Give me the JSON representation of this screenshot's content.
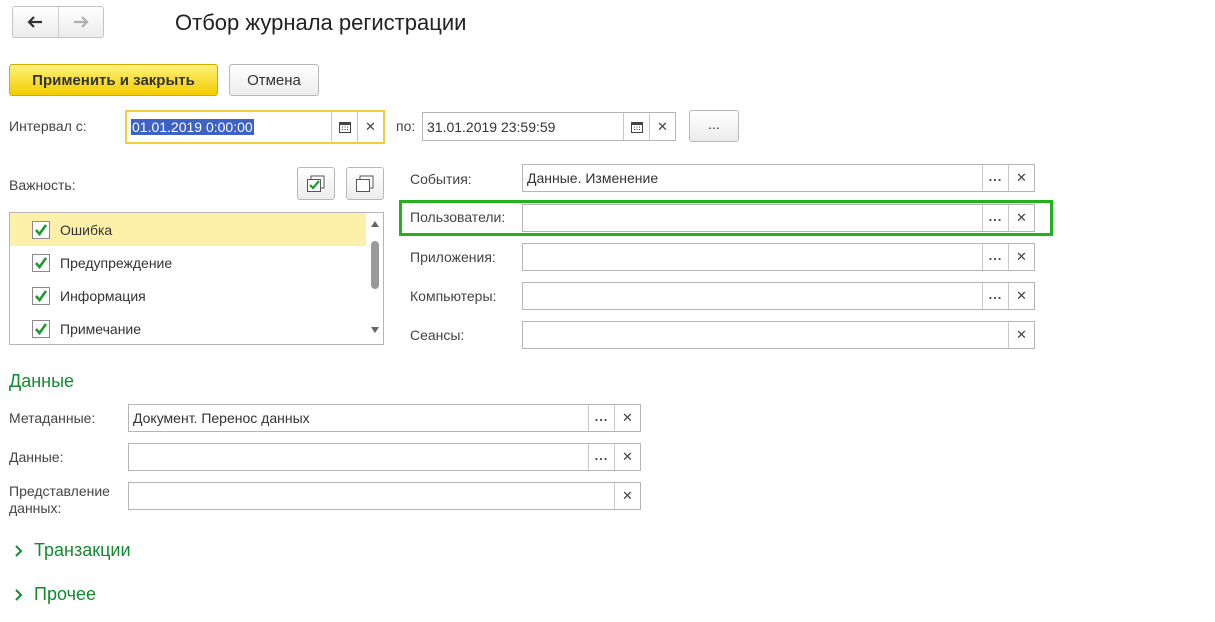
{
  "window": {
    "title": "Отбор журнала регистрации"
  },
  "nav": {
    "back_icon": "arrow-left-icon",
    "forward_icon": "arrow-right-icon"
  },
  "toolbar": {
    "apply_close_label": "Применить и закрыть",
    "cancel_label": "Отмена"
  },
  "interval": {
    "from_label": "Интервал с:",
    "from_value": "01.01.2019  0:00:00",
    "to_label": "по:",
    "to_value": "31.01.2019 23:59:59",
    "period_button": "..."
  },
  "importance": {
    "label": "Важность:",
    "items": [
      {
        "label": "Ошибка",
        "checked": true
      },
      {
        "label": "Предупреждение",
        "checked": true
      },
      {
        "label": "Информация",
        "checked": true
      },
      {
        "label": "Примечание",
        "checked": true
      }
    ]
  },
  "filters": {
    "events": {
      "label": "События:",
      "value": "Данные. Изменение"
    },
    "users": {
      "label": "Пользователи:",
      "value": ""
    },
    "applications": {
      "label": "Приложения:",
      "value": ""
    },
    "computers": {
      "label": "Компьютеры:",
      "value": ""
    },
    "sessions": {
      "label": "Сеансы:",
      "value": ""
    }
  },
  "data_section": {
    "title": "Данные",
    "metadata": {
      "label": "Метаданные:",
      "value": "Документ. Перенос данных"
    },
    "data": {
      "label": "Данные:",
      "value": ""
    },
    "presentation": {
      "label_line1": "Представление",
      "label_line2": "данных:",
      "value": ""
    }
  },
  "collapsed_groups": {
    "transactions": "Транзакции",
    "other": "Прочее"
  },
  "colors": {
    "accent_green": "#138a2f",
    "highlight": "#24b11c",
    "primary_button": "#f2cc00",
    "selection": "#3d62c6"
  }
}
